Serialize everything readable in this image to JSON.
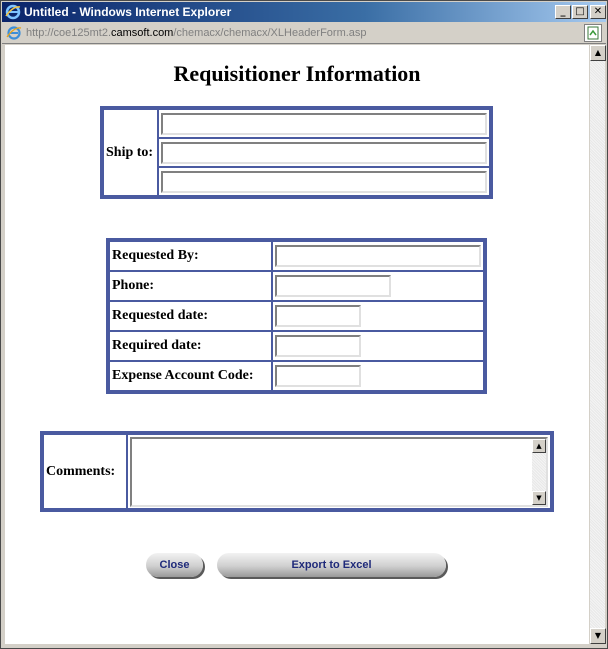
{
  "window": {
    "title": "Untitled - Windows Internet Explorer",
    "address_prefix": "http://coe125mt2.",
    "address_host": "camsoft.com",
    "address_path": "/chemacx/chemacx/XLHeaderForm.asp",
    "minimize": "_",
    "maximize": "□",
    "close": "✕"
  },
  "page": {
    "heading": "Requisitioner Information"
  },
  "ship_to": {
    "label": "Ship to:",
    "lines": [
      "",
      "",
      ""
    ]
  },
  "details": {
    "rows": [
      {
        "label": "Requested By:",
        "value": ""
      },
      {
        "label": "Phone:",
        "value": ""
      },
      {
        "label": "Requested date:",
        "value": ""
      },
      {
        "label": "Required date:",
        "value": ""
      },
      {
        "label": "Expense Account Code:",
        "value": ""
      }
    ]
  },
  "comments": {
    "label": "Comments:",
    "value": ""
  },
  "buttons": {
    "close": "Close",
    "export": "Export to Excel"
  },
  "colors": {
    "table_border": "#4a5aa0",
    "button_text": "#1f2a7a",
    "title_bar": "#0a246a"
  },
  "icons": {
    "title": "ie-icon",
    "address": "ie-page-icon",
    "address_right": "compat-view-icon"
  }
}
